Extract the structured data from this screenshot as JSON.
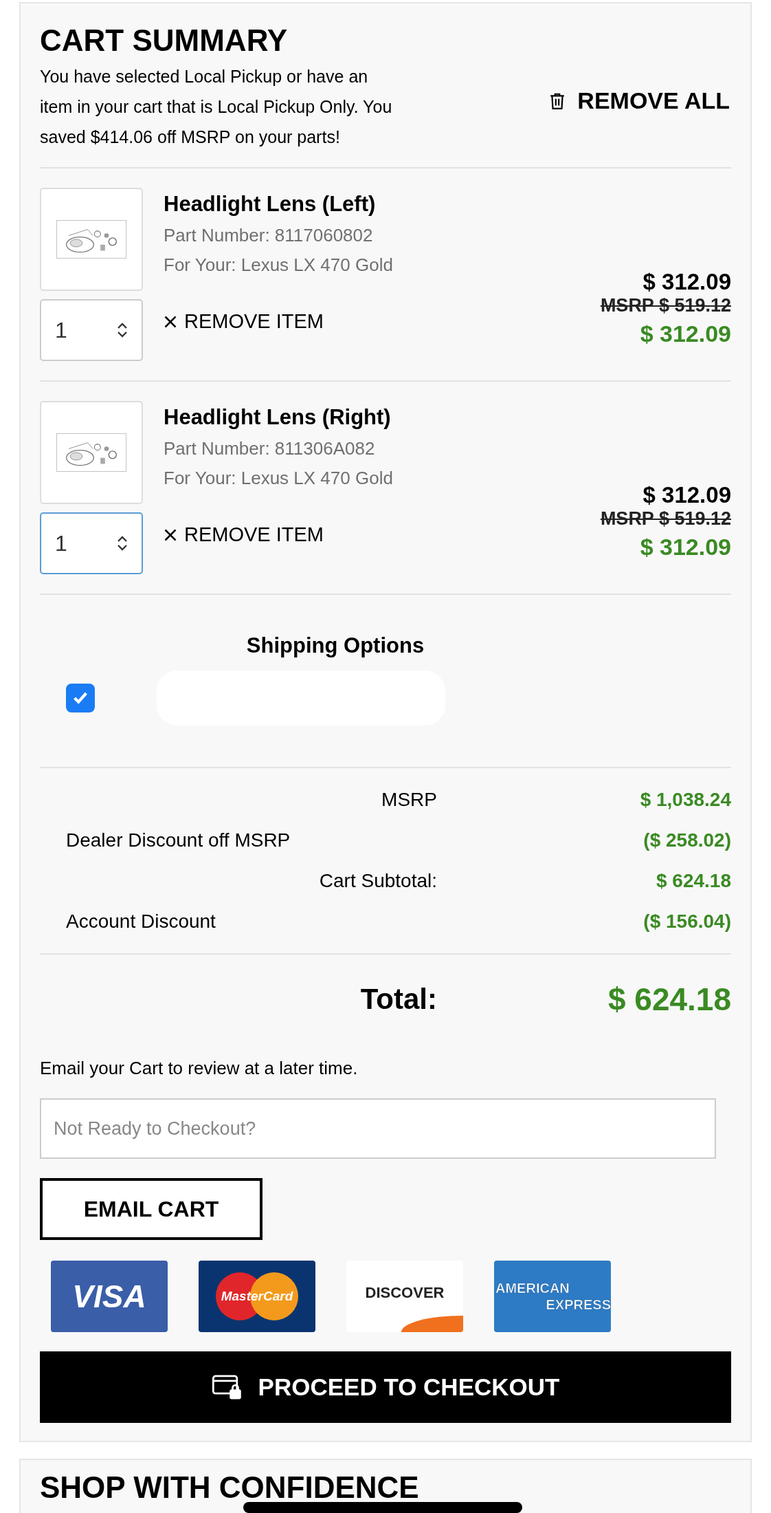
{
  "cart": {
    "title": "CART SUMMARY",
    "notice": "You have selected Local Pickup or have an item in your cart that is Local Pickup Only. You saved $414.06 off MSRP on your parts!",
    "remove_all": "REMOVE ALL"
  },
  "items": [
    {
      "name": "Headlight Lens (Left)",
      "part_number": "Part Number: 8117060802",
      "vehicle": "For Your: Lexus LX 470 Gold",
      "quantity": "1",
      "focused": false,
      "remove": "REMOVE ITEM",
      "price": "$ 312.09",
      "msrp": "MSRP $ 519.12",
      "sale_price": "$ 312.09"
    },
    {
      "name": "Headlight Lens (Right)",
      "part_number": "Part Number: 811306A082",
      "vehicle": "For Your: Lexus LX 470 Gold",
      "quantity": "1",
      "focused": true,
      "remove": "REMOVE ITEM",
      "price": "$ 312.09",
      "msrp": "MSRP $ 519.12",
      "sale_price": "$ 312.09"
    }
  ],
  "shipping": {
    "title": "Shipping Options",
    "options": [
      {
        "checked": true
      }
    ]
  },
  "summary": [
    {
      "kind": "amount",
      "label": "MSRP",
      "value": "$ 1,038.24"
    },
    {
      "kind": "discount",
      "label": "Dealer Discount off MSRP",
      "value": "($ 258.02)"
    },
    {
      "kind": "amount",
      "label": "Cart Subtotal:",
      "value": "$ 624.18"
    },
    {
      "kind": "discount",
      "label": "Account Discount",
      "value": "($ 156.04)"
    }
  ],
  "total": {
    "label": "Total:",
    "value": "$ 624.18"
  },
  "email": {
    "prompt": "Email your Cart to review at a later time.",
    "placeholder": "Not Ready to Checkout?",
    "button": "EMAIL CART"
  },
  "payment_cards": [
    {
      "kind": "visa",
      "lines": [
        "VISA"
      ]
    },
    {
      "kind": "mastercard",
      "lines": [
        "MasterCard"
      ]
    },
    {
      "kind": "discover",
      "lines": [
        "DISCOVER"
      ]
    },
    {
      "kind": "amex",
      "lines": [
        "AMERICAN",
        "EXPRESS"
      ]
    }
  ],
  "checkout": "PROCEED TO CHECKOUT",
  "next_section": {
    "title": "SHOP WITH CONFIDENCE"
  }
}
